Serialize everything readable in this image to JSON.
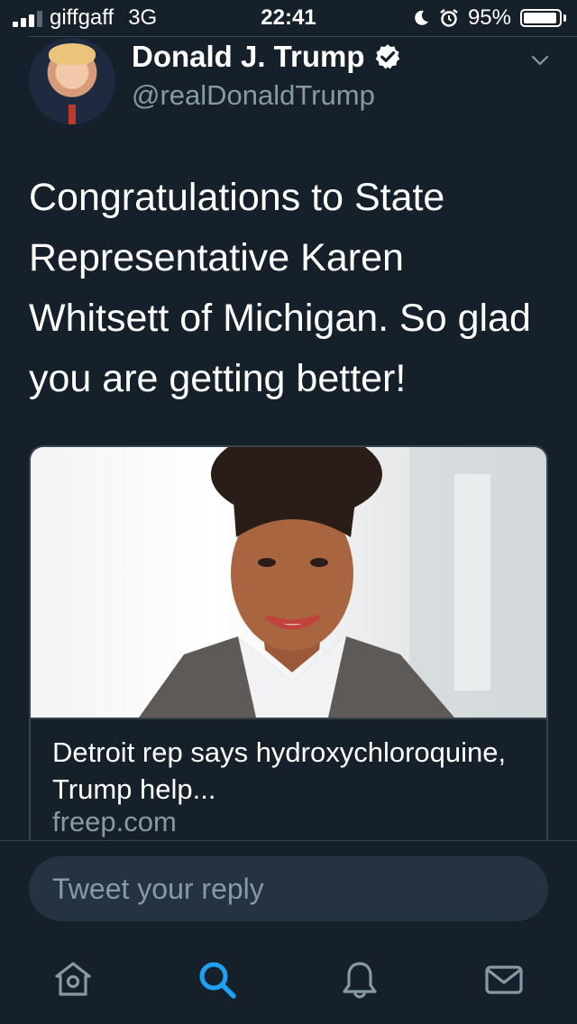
{
  "status_bar": {
    "carrier": "giffgaff",
    "network": "3G",
    "time": "22:41",
    "battery_percent": "95%",
    "battery_level": 0.95,
    "icons": [
      "signal-icon",
      "moon-icon",
      "alarm-icon",
      "battery-icon"
    ]
  },
  "tweet": {
    "author_name": "Donald J. Trump",
    "author_handle": "@realDonaldTrump",
    "verified": true,
    "text": "Congratulations to State Representative Karen Whitsett of Michigan. So glad you are getting better!",
    "card": {
      "title": "Detroit rep says hydroxychloroquine, Trump help...",
      "domain": "freep.com"
    }
  },
  "reply": {
    "placeholder": "Tweet your reply"
  },
  "tab_bar": {
    "items": [
      {
        "icon": "home-icon",
        "active": false
      },
      {
        "icon": "search-icon",
        "active": true
      },
      {
        "icon": "notifications-icon",
        "active": false
      },
      {
        "icon": "messages-icon",
        "active": false
      }
    ]
  },
  "colors": {
    "background": "#15202b",
    "accent": "#1da1f2",
    "secondary_text": "#8899a6",
    "divider": "#38444d",
    "input_bg": "#253341"
  }
}
